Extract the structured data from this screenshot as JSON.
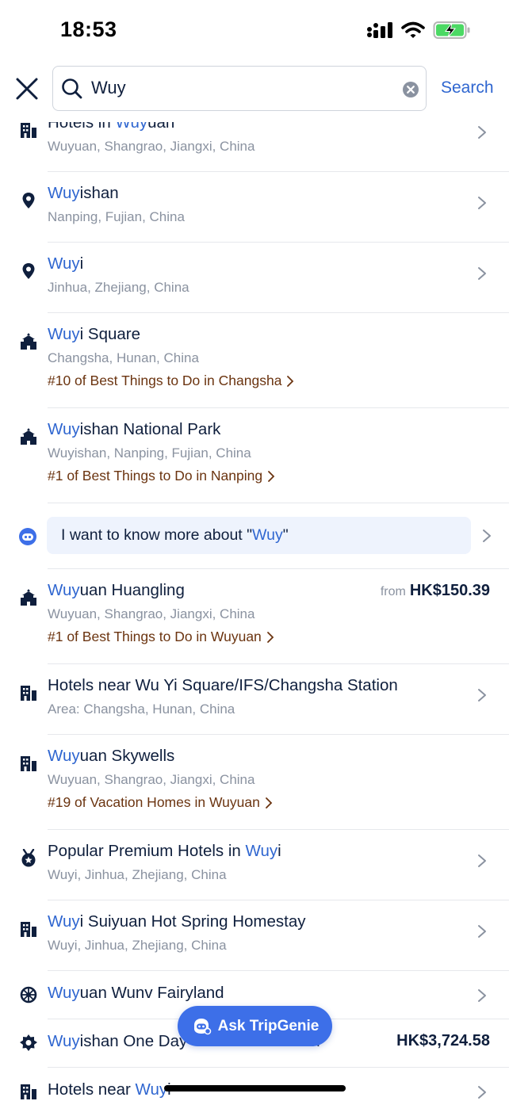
{
  "status_bar": {
    "time": "18:53"
  },
  "search": {
    "query": "Wuy",
    "button_label": "Search"
  },
  "results": [
    {
      "icon": "hotel-icon",
      "title_pre": "Hotels in ",
      "title_hl": "Wuy",
      "title_post": "uan",
      "subtitle": "Wuyuan, Shangrao, Jiangxi, China"
    },
    {
      "icon": "location-pin-icon",
      "title_pre": "",
      "title_hl": "Wuy",
      "title_post": "ishan",
      "subtitle": "Nanping, Fujian, China"
    },
    {
      "icon": "location-pin-icon",
      "title_pre": "",
      "title_hl": "Wuy",
      "title_post": "i",
      "subtitle": "Jinhua, Zhejiang, China"
    },
    {
      "icon": "attraction-icon",
      "title_pre": "",
      "title_hl": "Wuy",
      "title_post": "i Square",
      "subtitle": "Changsha, Hunan, China",
      "rank": "#10 of Best Things to Do in Changsha"
    },
    {
      "icon": "attraction-icon",
      "title_pre": "",
      "title_hl": "Wuy",
      "title_post": "ishan National Park",
      "subtitle": "Wuyishan, Nanping, Fujian, China",
      "rank": "#1 of Best Things to Do in Nanping"
    }
  ],
  "ai_prompt": {
    "pre": "I want to know more about \"",
    "hl": "Wuy",
    "post": "\""
  },
  "results2": [
    {
      "icon": "attraction-icon",
      "title_pre": "",
      "title_hl": "Wuy",
      "title_post": "uan Huangling",
      "subtitle": "Wuyuan, Shangrao, Jiangxi, China",
      "rank": "#1 of Best Things to Do in Wuyuan",
      "price_from": "from",
      "price": "HK$150.39"
    },
    {
      "icon": "hotel-icon",
      "title_pre": "Hotels near Wu Yi Square/IFS/Changsha Station",
      "title_hl": "",
      "title_post": "",
      "subtitle": "Area: Changsha, Hunan, China"
    },
    {
      "icon": "hotel-icon",
      "title_pre": "",
      "title_hl": "Wuy",
      "title_post": "uan Skywells",
      "subtitle": "Wuyuan, Shangrao, Jiangxi, China",
      "rank": "#19 of Vacation Homes in Wuyuan"
    },
    {
      "icon": "medal-icon",
      "title_pre": "Popular Premium Hotels in ",
      "title_hl": "Wuy",
      "title_post": "i",
      "subtitle": "Wuyi, Jinhua, Zhejiang, China"
    },
    {
      "icon": "hotel-icon",
      "title_pre": "",
      "title_hl": "Wuy",
      "title_post": "i Suiyuan Hot Spring Homestay",
      "subtitle": "Wuyi, Jinhua, Zhejiang, China"
    },
    {
      "icon": "theme-park-icon",
      "title_pre": "",
      "title_hl": "Wuy",
      "title_post": "uan Wunv Fairyland"
    },
    {
      "icon": "tour-icon",
      "title_pre": "",
      "title_hl": "Wuy",
      "title_post": "ishan One Day",
      "title_tail": "ain",
      "price": "HK$3,724.58"
    },
    {
      "icon": "hotel-icon",
      "title_pre": "Hotels near ",
      "title_hl": "Wuy",
      "title_post": "i"
    }
  ],
  "ask_button": {
    "label": "Ask TripGenie"
  }
}
